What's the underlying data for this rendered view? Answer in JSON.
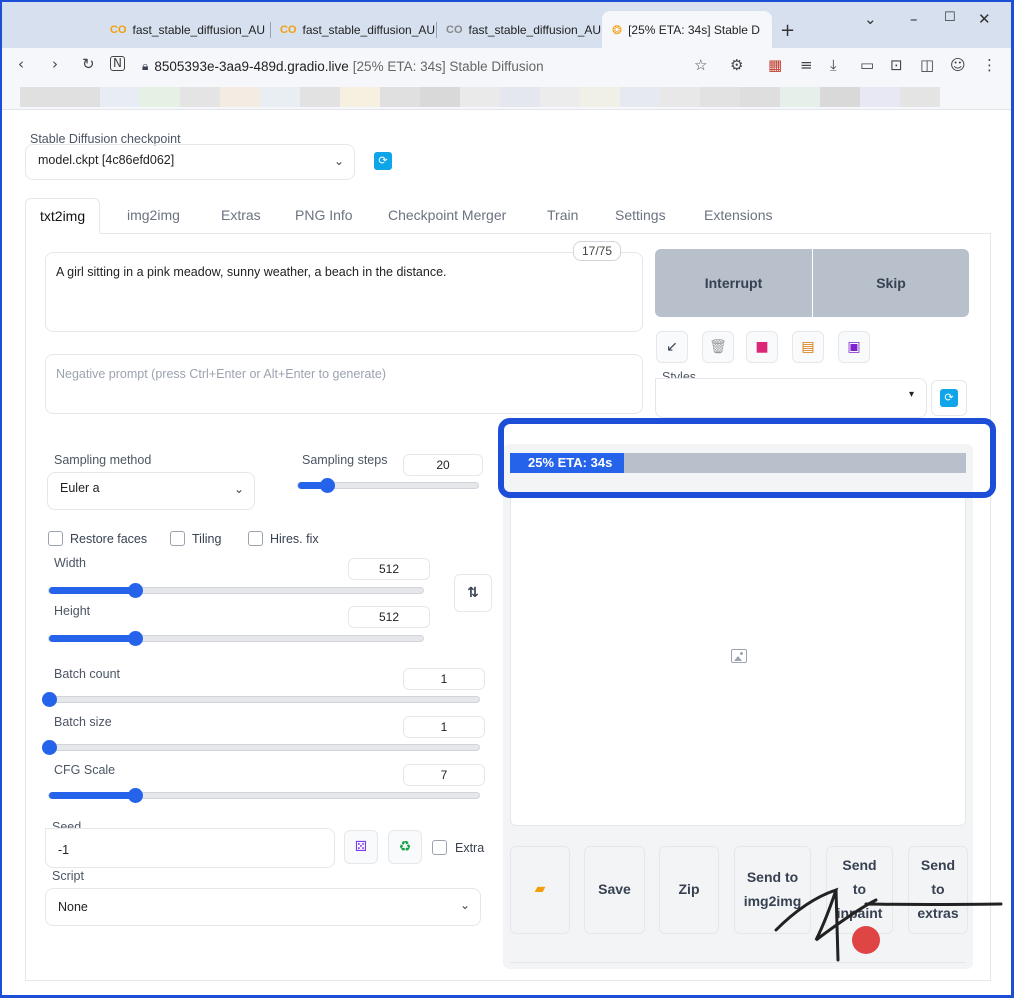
{
  "browser": {
    "tabs": [
      {
        "title": "fast_stable_diffusion_AU"
      },
      {
        "title": "fast_stable_diffusion_AU"
      },
      {
        "title": "fast_stable_diffusion_AU"
      },
      {
        "title": "[25% ETA: 34s] Stable D"
      }
    ],
    "url_host": "8505393e-3aa9-489d.gradio.live",
    "url_title": "[25% ETA: 34s] Stable Diffusion"
  },
  "checkpoint": {
    "label": "Stable Diffusion checkpoint",
    "value": "model.ckpt [4c86efd062]"
  },
  "main_tabs": [
    "txt2img",
    "img2img",
    "Extras",
    "PNG Info",
    "Checkpoint Merger",
    "Train",
    "Settings",
    "Extensions"
  ],
  "prompt": {
    "text": "A girl sitting in a pink meadow, sunny weather, a beach in the distance.",
    "token_count": "17/75",
    "negative_placeholder": "Negative prompt (press Ctrl+Enter or Alt+Enter to generate)"
  },
  "actions": {
    "interrupt": "Interrupt",
    "skip": "Skip"
  },
  "styles": {
    "label": "Styles",
    "value": ""
  },
  "sampling": {
    "method_label": "Sampling method",
    "method_value": "Euler a",
    "steps_label": "Sampling steps",
    "steps_value": "20",
    "steps_fraction": 0.16
  },
  "checkboxes": {
    "restore_faces": "Restore faces",
    "tiling": "Tiling",
    "hires_fix": "Hires. fix"
  },
  "width": {
    "label": "Width",
    "value": "512",
    "fraction": 0.23
  },
  "height": {
    "label": "Height",
    "value": "512",
    "fraction": 0.23
  },
  "batch_count": {
    "label": "Batch count",
    "value": "1",
    "fraction": 0.0
  },
  "batch_size": {
    "label": "Batch size",
    "value": "1",
    "fraction": 0.0
  },
  "cfg_scale": {
    "label": "CFG Scale",
    "value": "7",
    "fraction": 0.2
  },
  "seed": {
    "label": "Seed",
    "value": "-1",
    "extra_label": "Extra"
  },
  "script": {
    "label": "Script",
    "value": "None"
  },
  "progress": {
    "text": "25% ETA: 34s",
    "fraction": 0.25
  },
  "output_buttons": {
    "save": "Save",
    "zip": "Zip",
    "send_img2img": "Send to img2img",
    "send_inpaint": "Send to inpaint",
    "send_extras": "Send to extras"
  },
  "colors": {
    "accent": "#2563eb",
    "highlight": "#1d4ed8",
    "button_gray": "#b8c0cc"
  }
}
